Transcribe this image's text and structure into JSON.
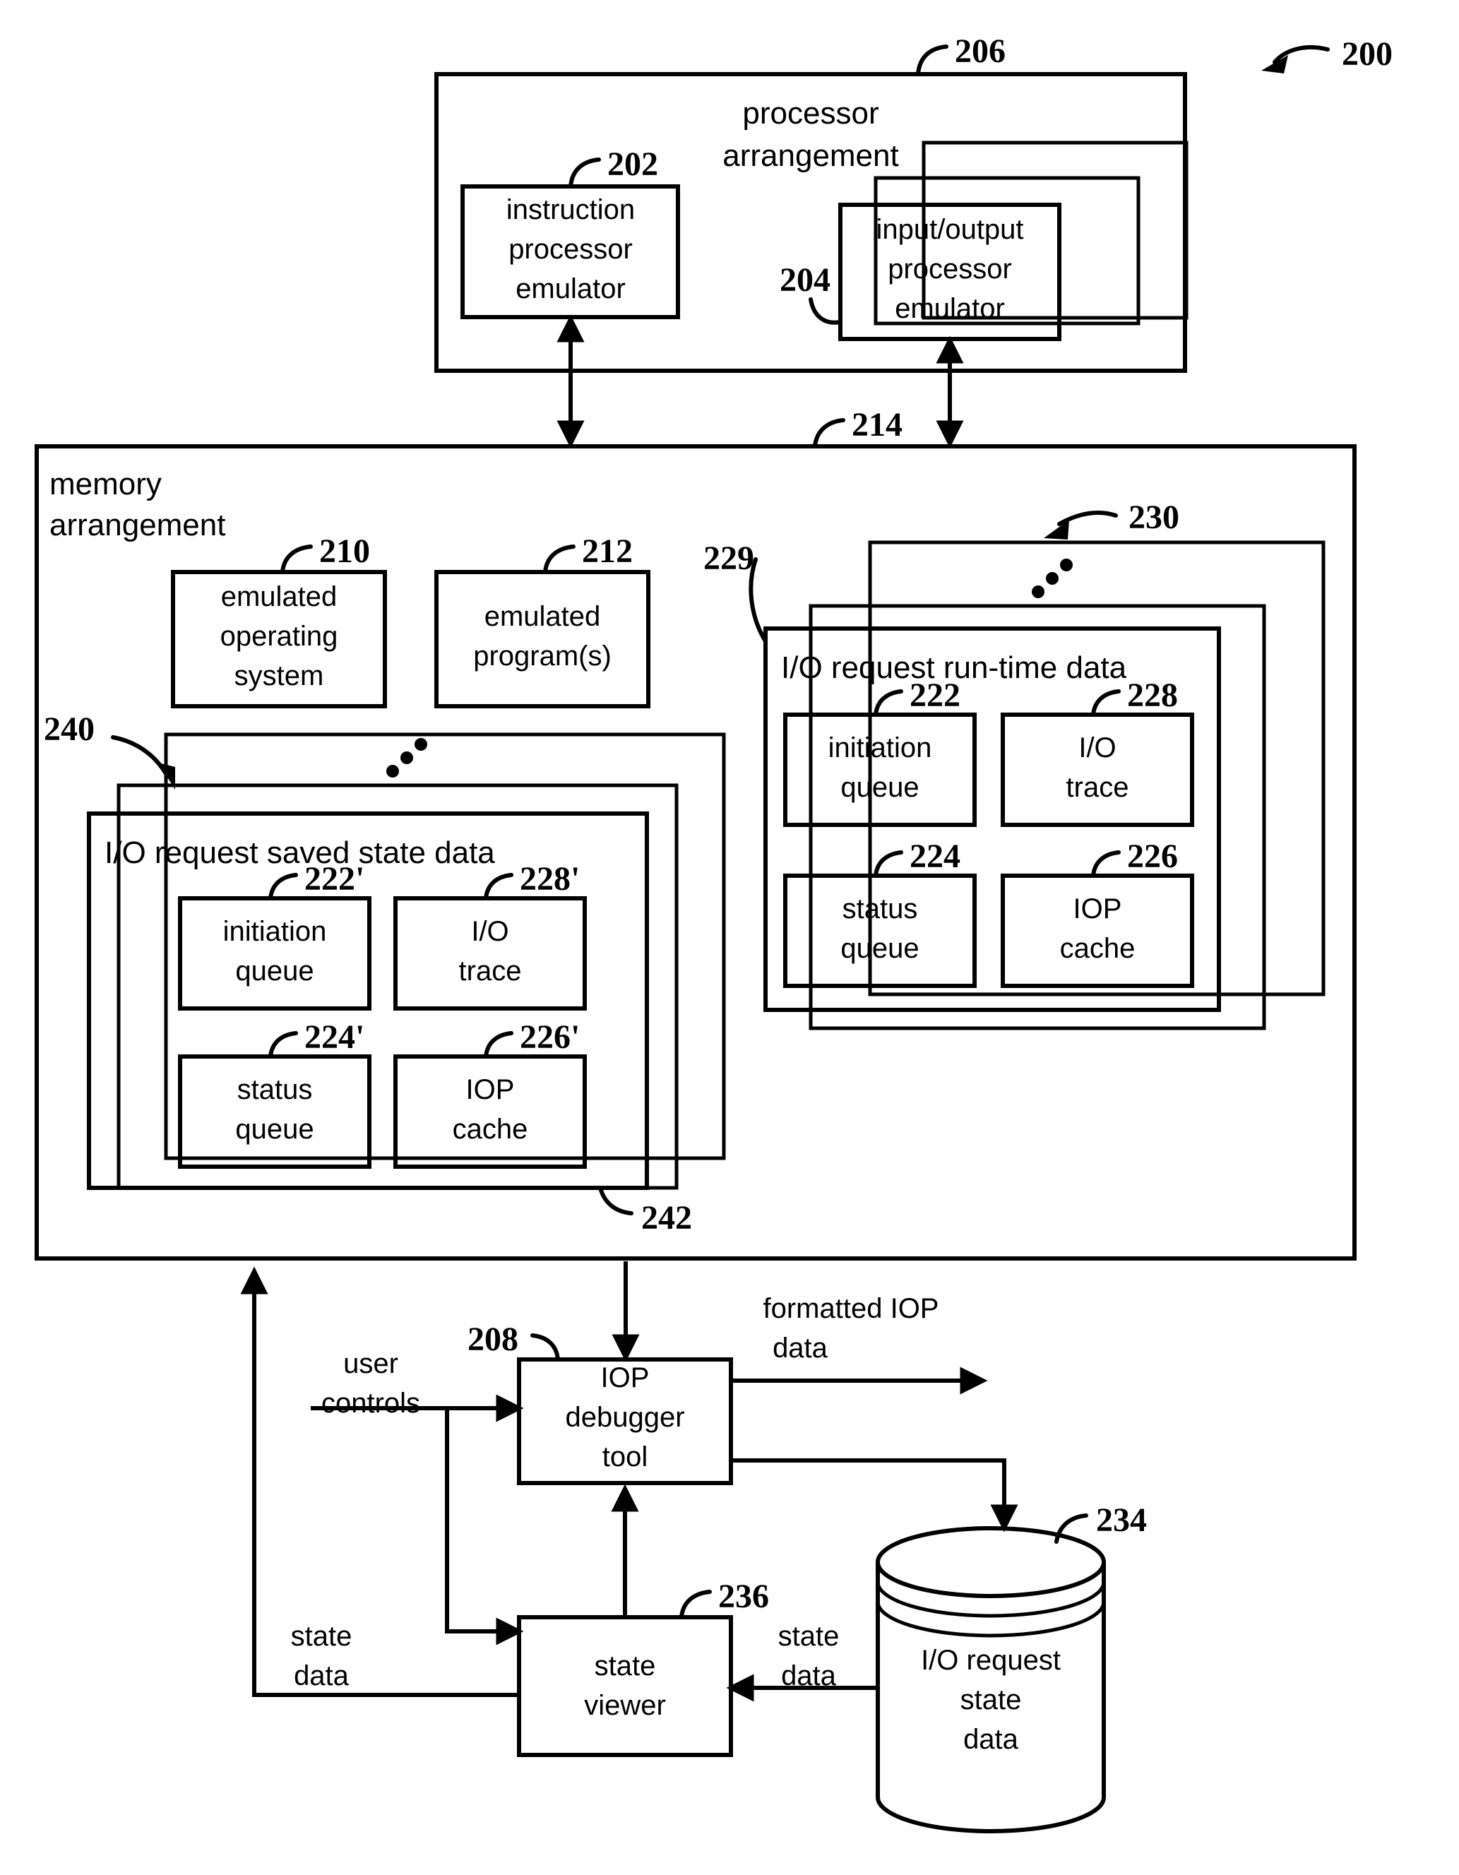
{
  "figure": {
    "ref_200": "200",
    "processor_arrangement": {
      "ref": "206",
      "title_line1": "processor",
      "title_line2": "arrangement",
      "instruction_processor_emulator": {
        "ref": "202",
        "line1": "instruction",
        "line2": "processor",
        "line3": "emulator"
      },
      "io_processor_emulator": {
        "ref": "204",
        "line1": "input/output",
        "line2": "processor",
        "line3": "emulator"
      }
    },
    "memory_arrangement": {
      "ref": "214",
      "title_line1": "memory",
      "title_line2": "arrangement",
      "emulated_operating_system": {
        "ref": "210",
        "line1": "emulated",
        "line2": "operating",
        "line3": "system"
      },
      "emulated_programs": {
        "ref": "212",
        "line1": "emulated",
        "line2": "program(s)"
      },
      "runtime_data": {
        "ref_stack": "230",
        "ref_front": "229",
        "title": "I/O request run-time data",
        "items": [
          {
            "ref": "222",
            "line1": "initiation",
            "line2": "queue"
          },
          {
            "ref": "228",
            "line1": "I/O",
            "line2": "trace"
          },
          {
            "ref": "224",
            "line1": "status",
            "line2": "queue"
          },
          {
            "ref": "226",
            "line1": "IOP",
            "line2": "cache"
          }
        ]
      },
      "saved_state_data": {
        "ref_stack": "240",
        "ref_front": "242",
        "title": "I/O request saved state data",
        "items": [
          {
            "ref": "222'",
            "line1": "initiation",
            "line2": "queue"
          },
          {
            "ref": "228'",
            "line1": "I/O",
            "line2": "trace"
          },
          {
            "ref": "224'",
            "line1": "status",
            "line2": "queue"
          },
          {
            "ref": "226'",
            "line1": "IOP",
            "line2": "cache"
          }
        ]
      }
    },
    "iop_debugger_tool": {
      "ref": "208",
      "line1": "IOP",
      "line2": "debugger",
      "line3": "tool"
    },
    "state_viewer": {
      "ref": "236",
      "line1": "state",
      "line2": "viewer"
    },
    "io_request_state_data_store": {
      "ref": "234",
      "line1": "I/O request",
      "line2": "state",
      "line3": "data"
    },
    "edge_labels": {
      "user_controls_l1": "user",
      "user_controls_l2": "controls",
      "formatted_iop_l1": "formatted IOP",
      "formatted_iop_l2": "data",
      "state_data_left_l1": "state",
      "state_data_left_l2": "data",
      "state_data_right_l1": "state",
      "state_data_right_l2": "data"
    }
  }
}
